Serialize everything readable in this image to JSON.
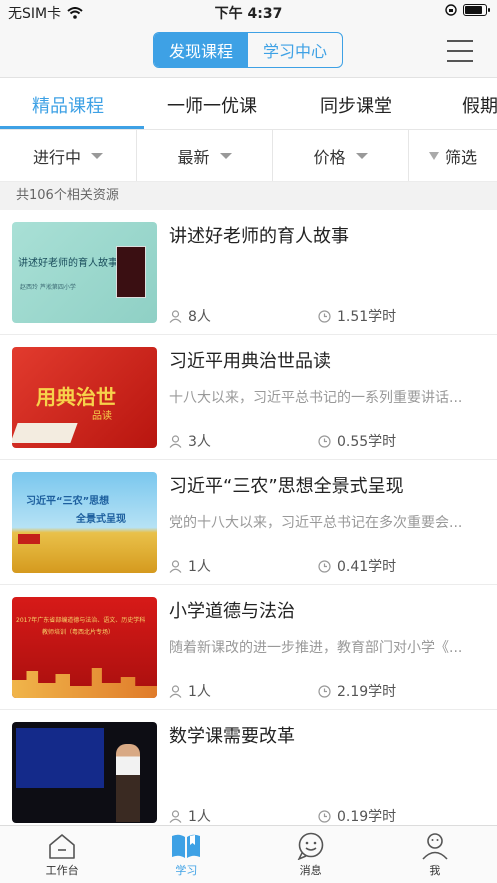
{
  "status": {
    "carrier": "无SIM卡",
    "time": "下午 4:37",
    "battery_level": 0.9
  },
  "top_nav": {
    "segments": [
      "发现课程",
      "学习中心"
    ],
    "active_segment": 0
  },
  "categories": {
    "items": [
      "精品课程",
      "一师一优课",
      "同步课堂",
      "假期"
    ],
    "active": 0
  },
  "filters": [
    "进行中",
    "最新",
    "价格",
    "筛选"
  ],
  "result_count": "共106个相关资源",
  "courses": [
    {
      "title": "讲述好老师的育人故事",
      "desc": "",
      "users": "8人",
      "hours": "1.51学时",
      "thumb_text": "讲述好老师的育人故事",
      "thumb_sub": "赵西玲  芦淞第四小学"
    },
    {
      "title": "习近平用典治世品读",
      "desc": "十八大以来，习近平总书记的一系列重要讲话...",
      "users": "3人",
      "hours": "0.55学时",
      "thumb_text": "用典治世",
      "thumb_sub": "品读"
    },
    {
      "title": "习近平“三农”思想全景式呈现",
      "desc": "党的十八大以来，习近平总书记在多次重要会...",
      "users": "1人",
      "hours": "0.41学时",
      "thumb_text": "习近平“三农”思想",
      "thumb_sub": "全景式呈现"
    },
    {
      "title": "小学道德与法治",
      "desc": "随着新课改的进一步推进，教育部门对小学《...",
      "users": "1人",
      "hours": "2.19学时",
      "thumb_text": "2017年广东省部编道德与法治、语文、历史学科",
      "thumb_sub": "教师培训（粤西北片专场）"
    },
    {
      "title": "数学课需要改革",
      "desc": "",
      "users": "1人",
      "hours": "0.19学时",
      "thumb_text": "",
      "thumb_sub": ""
    }
  ],
  "bottom_tabs": [
    {
      "label": "工作台",
      "icon": "home-icon"
    },
    {
      "label": "学习",
      "icon": "book-icon"
    },
    {
      "label": "消息",
      "icon": "message-icon"
    },
    {
      "label": "我",
      "icon": "profile-icon"
    }
  ],
  "colors": {
    "accent": "#3ea1e5",
    "muted": "#999999"
  }
}
